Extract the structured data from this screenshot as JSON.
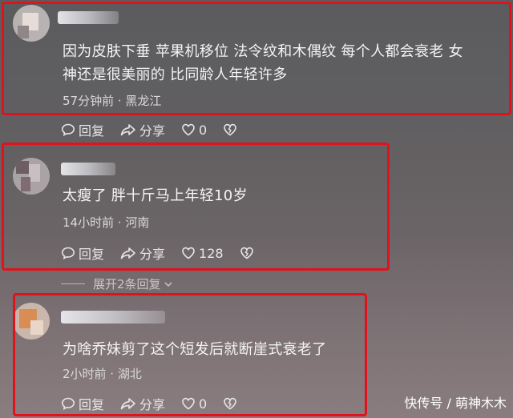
{
  "comments": [
    {
      "text_line1": "因为皮肤下垂 苹果机移位 法令纹和木偶纹 每个人都会衰老 女",
      "text_line2": "神还是很美丽的 比同龄人年轻许多",
      "meta": "57分钟前 · 黑龙江",
      "reply_label": "回复",
      "share_label": "分享",
      "likes": "0"
    },
    {
      "text_line1": "太瘦了 胖十斤马上年轻10岁",
      "meta": "14小时前 · 河南",
      "reply_label": "回复",
      "share_label": "分享",
      "likes": "128"
    },
    {
      "text_line1": "为啥乔妹剪了这个短发后就断崖式衰老了",
      "meta": "2小时前 · 湖北",
      "reply_label": "回复",
      "share_label": "分享",
      "likes": "0"
    }
  ],
  "expand_replies": "展开2条回复",
  "watermark": "快传号 / 萌神木木",
  "colors": {
    "highlight_border": "#e0121b",
    "text": "#f4f4f4",
    "meta_text": "#d9d9db"
  },
  "icons": [
    "comment-bubble-icon",
    "share-arrow-icon",
    "heart-icon",
    "broken-heart-icon",
    "chevron-down-icon"
  ]
}
